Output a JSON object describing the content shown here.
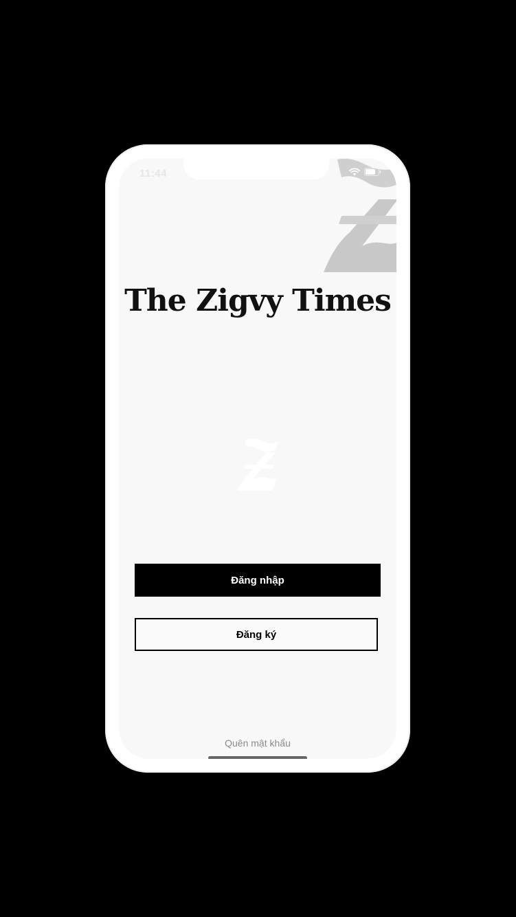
{
  "status_bar": {
    "time": "11:44",
    "icons": [
      "wifi-icon",
      "battery-icon"
    ]
  },
  "brand": {
    "logo_text": "The Zigvy Times",
    "watermark_letter": "Z"
  },
  "actions": {
    "login_label": "Đăng nhập",
    "register_label": "Đăng ký",
    "forgot_password_label": "Quên mật khẩu"
  },
  "colors": {
    "background": "#000000",
    "screen": "#f8f8f8",
    "primary_button": "#000000",
    "primary_button_text": "#ffffff",
    "link_text": "#8a8a8a"
  }
}
